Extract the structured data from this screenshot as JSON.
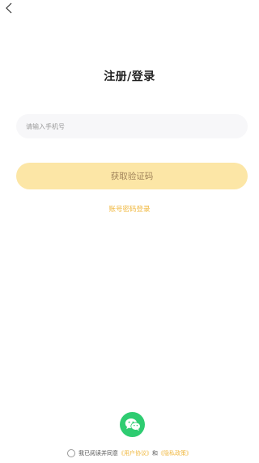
{
  "header": {
    "back_icon": "chevron-left-icon"
  },
  "title": "注册/登录",
  "phone": {
    "placeholder": "请输入手机号",
    "value": ""
  },
  "code_button": {
    "label": "获取验证码",
    "color": "#fce6a6",
    "text_color": "#a0835a"
  },
  "password_login": {
    "label": "账号密码登录",
    "color": "#f0b840"
  },
  "wechat": {
    "icon": "wechat-icon",
    "color": "#2ecc71"
  },
  "agreement": {
    "checked": false,
    "prefix": "我已阅读并同意",
    "user_agreement": "《用户协议》",
    "and": "和",
    "privacy_policy": "《隐私政策》"
  }
}
